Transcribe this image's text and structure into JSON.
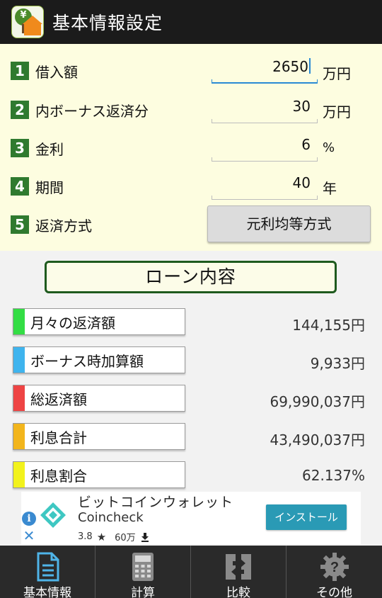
{
  "header": {
    "title": "基本情報設定"
  },
  "settings": [
    {
      "number": "1",
      "label": "借入額",
      "value": "2650",
      "unit": "万円",
      "focused": true
    },
    {
      "number": "2",
      "label": "内ボーナス返済分",
      "value": "30",
      "unit": "万円",
      "focused": false
    },
    {
      "number": "3",
      "label": "金利",
      "value": "6",
      "unit": "%",
      "focused": false
    },
    {
      "number": "4",
      "label": "期間",
      "value": "40",
      "unit": "年",
      "focused": false
    }
  ],
  "repayment": {
    "number": "5",
    "label": "返済方式",
    "button_label": "元利均等方式"
  },
  "loan_content": {
    "title": "ローン内容",
    "results": [
      {
        "label": "月々の返済額",
        "value": "144,155円",
        "color": "#33dd44"
      },
      {
        "label": "ボーナス時加算額",
        "value": "9,933円",
        "color": "#3fb4ee"
      },
      {
        "label": "総返済額",
        "value": "69,990,037円",
        "color": "#ee4444"
      },
      {
        "label": "利息合計",
        "value": "43,490,037円",
        "color": "#f2b51c"
      },
      {
        "label": "利息割合",
        "value": "62.137%",
        "color": "#f2f21c"
      }
    ]
  },
  "ad": {
    "title": "ビットコインウォレット",
    "brand": "Coincheck",
    "rating": "3.8",
    "downloads": "60万",
    "install_label": "インストール",
    "accent": "#2a9ab5"
  },
  "bottom_nav": [
    {
      "label": "基本情報",
      "icon": "document-icon"
    },
    {
      "label": "計算",
      "icon": "calculator-icon"
    },
    {
      "label": "比較",
      "icon": "compare-icon"
    },
    {
      "label": "その他",
      "icon": "gear-question-icon"
    }
  ]
}
